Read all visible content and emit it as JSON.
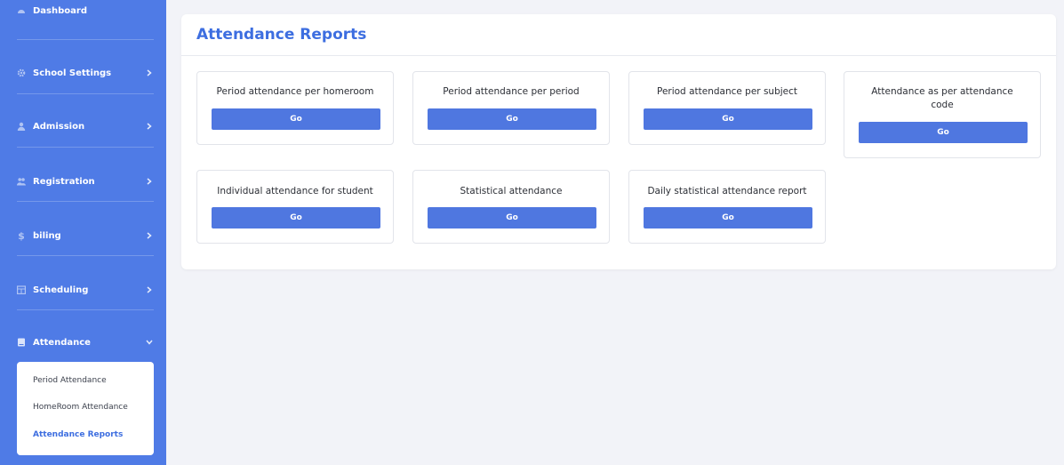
{
  "sidebar": {
    "items": [
      {
        "label": "Dashboard",
        "icon": "dashboard-icon"
      },
      {
        "label": "School Settings",
        "icon": "gear-icon"
      },
      {
        "label": "Admission",
        "icon": "user-icon"
      },
      {
        "label": "Registration",
        "icon": "users-icon"
      },
      {
        "label": "biling",
        "icon": "dollar-icon"
      },
      {
        "label": "Scheduling",
        "icon": "calendar-icon"
      },
      {
        "label": "Attendance",
        "icon": "book-icon"
      }
    ],
    "submenu": [
      {
        "label": "Period Attendance"
      },
      {
        "label": "HomeRoom Attendance"
      },
      {
        "label": "Attendance Reports",
        "active": true
      }
    ]
  },
  "main": {
    "title": "Attendance Reports",
    "button_label": "Go",
    "cards": [
      {
        "title": "Period attendance per homeroom"
      },
      {
        "title": "Period attendance per period"
      },
      {
        "title": "Period attendance per subject"
      },
      {
        "title": "Attendance as per attendance code"
      },
      {
        "title": "Individual attendance for student"
      },
      {
        "title": "Statistical attendance"
      },
      {
        "title": "Daily statistical attendance report"
      }
    ]
  },
  "colors": {
    "sidebar": "#4f7be6",
    "accent": "#3d6ee0",
    "button": "#4f77e0",
    "background": "#f2f3f8"
  }
}
